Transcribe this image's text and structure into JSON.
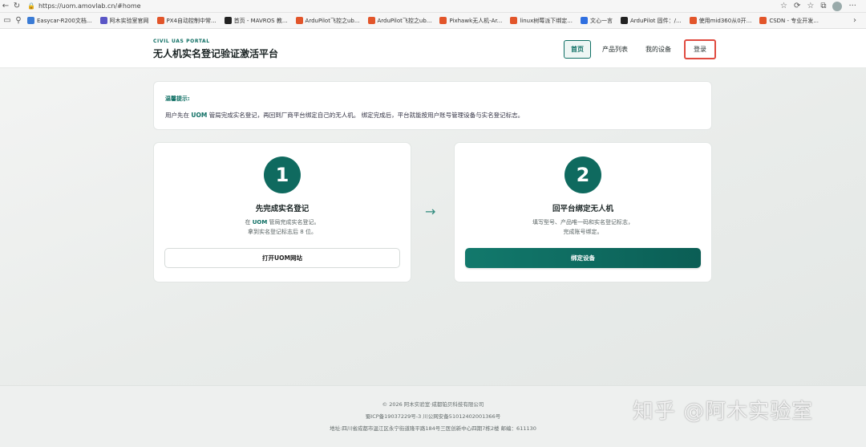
{
  "browser": {
    "url": "https://uom.amovlab.cn/#home",
    "bookmarks": [
      {
        "label": "Easycar-R200文档...",
        "color": "#3a7bd5"
      },
      {
        "label": "阿木实验室官网",
        "color": "#5a56c6"
      },
      {
        "label": "PX4自动控制中常...",
        "color": "#e2552a"
      },
      {
        "label": "首页 - MAVROS 教...",
        "color": "#222222"
      },
      {
        "label": "ArduPilot飞控之ub...",
        "color": "#e2552a"
      },
      {
        "label": "ArduPilot飞控之ub...",
        "color": "#e2552a"
      },
      {
        "label": "Pixhawk无人机-Ar...",
        "color": "#e2552a"
      },
      {
        "label": "linux树莓派下绑定...",
        "color": "#e2552a"
      },
      {
        "label": "文心一言",
        "color": "#2f6fe0"
      },
      {
        "label": "ArduPilot 固件：/...",
        "color": "#222222"
      },
      {
        "label": "使用mid360从0开...",
        "color": "#e2552a"
      },
      {
        "label": "CSDN - 专业开发...",
        "color": "#e2552a"
      }
    ]
  },
  "header": {
    "eyebrow": "CIVIL UAS PORTAL",
    "title": "无人机实名登记验证激活平台",
    "nav": {
      "home": "首页",
      "products": "产品列表",
      "devices": "我的设备",
      "login": "登录"
    }
  },
  "notice": {
    "title": "温馨提示:",
    "body_prefix": "用户先在",
    "body_uom": "UOM",
    "body_suffix": "管局完成实名登记，再回到厂商平台绑定自己的无人机。 绑定完成后，平台就能按用户账号管理设备与实名登记标志。"
  },
  "steps": [
    {
      "number": "1",
      "title": "先完成实名登记",
      "desc_prefix": "在",
      "desc_uom": "UOM",
      "desc_suffix": "管局完成实名登记。",
      "desc_line2": "拿到实名登记标志后 8 位。",
      "button": "打开UOM网站"
    },
    {
      "number": "2",
      "title": "回平台绑定无人机",
      "desc_line1": "填写型号、产品唯一码和实名登记标志，",
      "desc_line2": "完成账号绑定。",
      "button": "绑定设备"
    }
  ],
  "arrow": "→",
  "footer": {
    "line1": "© 2026 阿木实验室·成都铂贝科技有限公司",
    "line2": "蜀ICP备19037229号-3 川公网安备51012402001366号",
    "line3": "地址:四川省成都市温江区永宁街道隆平路184号三医创新中心四期7栋2楼  邮编：611130"
  },
  "watermark": "知乎 @阿木实验室",
  "colors": {
    "accent": "#0f6f64",
    "login_highlight": "#e04b40"
  }
}
